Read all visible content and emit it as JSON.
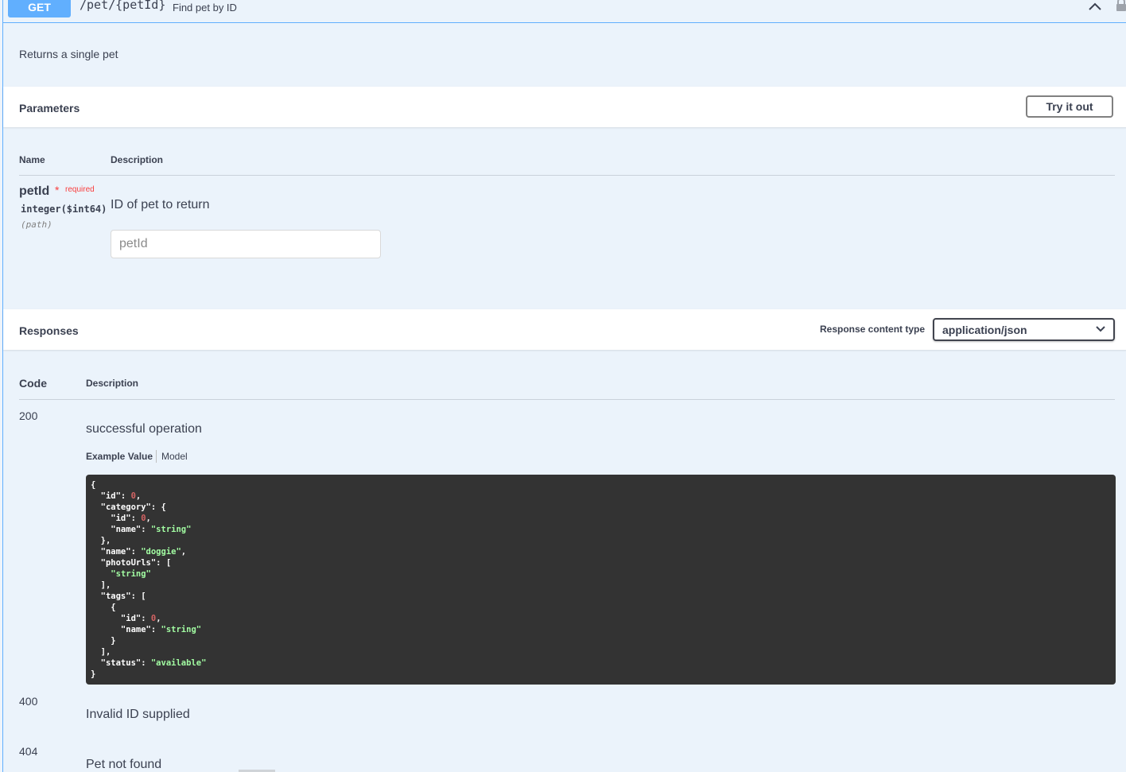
{
  "operation": {
    "method": "GET",
    "path": "/pet/{petId}",
    "summary": "Find pet by ID",
    "description": "Returns a single pet"
  },
  "parameters": {
    "title": "Parameters",
    "try_label": "Try it out",
    "col_name": "Name",
    "col_description": "Description",
    "items": [
      {
        "name": "petId",
        "star": "*",
        "required_label": "required",
        "type": "integer($int64)",
        "in": "(path)",
        "description": "ID of pet to return",
        "placeholder": "petId"
      }
    ]
  },
  "responses": {
    "title": "Responses",
    "content_type_label": "Response content type",
    "content_type": "application/json",
    "col_code": "Code",
    "col_description": "Description",
    "items": [
      {
        "code": "200",
        "description": "successful operation"
      },
      {
        "code": "400",
        "description": "Invalid ID supplied"
      },
      {
        "code": "404",
        "description": "Pet not found"
      }
    ],
    "tab_example": "Example Value",
    "tab_model": "Model",
    "example_json": "{\n  \"id\": 0,\n  \"category\": {\n    \"id\": 0,\n    \"name\": \"string\"\n  },\n  \"name\": \"doggie\",\n  \"photoUrls\": [\n    \"string\"\n  ],\n  \"tags\": [\n    {\n      \"id\": 0,\n      \"name\": \"string\"\n    }\n  ],\n  \"status\": \"available\"\n}"
  },
  "colors": {
    "get_method": "#61affe",
    "opblock_bg": "#ebf3fb",
    "required": "#f93e3e",
    "code_bg": "#333333",
    "code_number": "#d36363",
    "code_string": "#a2fca2"
  }
}
